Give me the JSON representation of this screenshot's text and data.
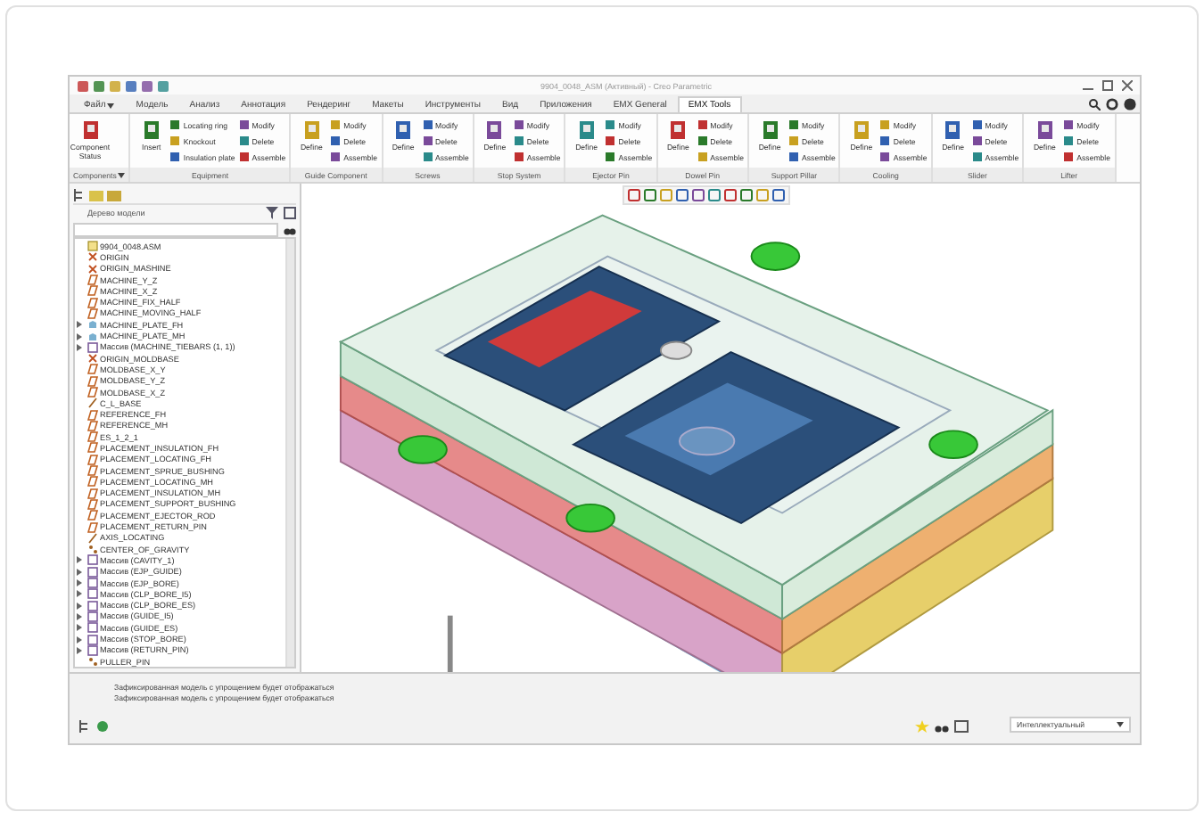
{
  "window": {
    "title": "9904_0048_ASM (Активный) - Creo Parametric"
  },
  "tabs": [
    {
      "label": "Файл",
      "selected": false,
      "menu": true
    },
    {
      "label": "Модель",
      "selected": false,
      "menu": false
    },
    {
      "label": "Анализ",
      "selected": false,
      "menu": false
    },
    {
      "label": "Аннотация",
      "selected": false,
      "menu": false
    },
    {
      "label": "Рендеринг",
      "selected": false,
      "menu": false
    },
    {
      "label": "Макеты",
      "selected": false,
      "menu": false
    },
    {
      "label": "Инструменты",
      "selected": false,
      "menu": false
    },
    {
      "label": "Вид",
      "selected": false,
      "menu": false
    },
    {
      "label": "Приложения",
      "selected": false,
      "menu": false
    },
    {
      "label": "EMX General",
      "selected": false,
      "menu": false
    },
    {
      "label": "EMX Tools",
      "selected": true,
      "menu": false
    }
  ],
  "ribbon_groups": [
    {
      "label": "Components",
      "menu": true,
      "large": [
        "Component Status"
      ]
    },
    {
      "label": "Equipment",
      "menu": false,
      "large": [
        "Insert"
      ],
      "small": [
        "Locating ring",
        "Knockout",
        "Insulation plate",
        "Modify",
        "Delete",
        "Assemble"
      ]
    },
    {
      "label": "Guide Component",
      "menu": false,
      "large": [
        "Define"
      ],
      "small": [
        "Modify",
        "Delete",
        "Assemble"
      ]
    },
    {
      "label": "Screws",
      "menu": false,
      "large": [
        "Define"
      ],
      "small": [
        "Modify",
        "Delete",
        "Assemble"
      ]
    },
    {
      "label": "Stop System",
      "menu": false,
      "large": [
        "Define"
      ],
      "small": [
        "Modify",
        "Delete",
        "Assemble"
      ]
    },
    {
      "label": "Ejector Pin",
      "menu": false,
      "large": [
        "Define"
      ],
      "small": [
        "Modify",
        "Delete",
        "Assemble"
      ]
    },
    {
      "label": "Dowel Pin",
      "menu": false,
      "large": [
        "Define"
      ],
      "small": [
        "Modify",
        "Delete",
        "Assemble"
      ]
    },
    {
      "label": "Support Pillar",
      "menu": false,
      "large": [
        "Define"
      ],
      "small": [
        "Modify",
        "Delete",
        "Assemble"
      ]
    },
    {
      "label": "Cooling",
      "menu": false,
      "large": [
        "Define"
      ],
      "small": [
        "Modify",
        "Delete",
        "Assemble"
      ]
    },
    {
      "label": "Slider",
      "menu": false,
      "large": [
        "Define"
      ],
      "small": [
        "Modify",
        "Delete",
        "Assemble"
      ]
    },
    {
      "label": "Lifter",
      "menu": false,
      "large": [
        "Define"
      ],
      "small": [
        "Modify",
        "Delete",
        "Assemble"
      ]
    }
  ],
  "model_tree": {
    "title": "Дерево модели",
    "items": [
      {
        "label": "9904_0048.ASM",
        "kind": "assembly",
        "expandable": false
      },
      {
        "label": "ORIGIN",
        "kind": "csys",
        "expandable": false
      },
      {
        "label": "ORIGIN_MASHINE",
        "kind": "csys",
        "expandable": false
      },
      {
        "label": "MACHINE_Y_Z",
        "kind": "plane",
        "expandable": false
      },
      {
        "label": "MACHINE_X_Z",
        "kind": "plane",
        "expandable": false
      },
      {
        "label": "MACHINE_FIX_HALF",
        "kind": "plane",
        "expandable": false
      },
      {
        "label": "MACHINE_MOVING_HALF",
        "kind": "plane",
        "expandable": false
      },
      {
        "label": "MACHINE_PLATE_FH",
        "kind": "part",
        "expandable": true
      },
      {
        "label": "MACHINE_PLATE_MH",
        "kind": "part",
        "expandable": true
      },
      {
        "label": "Массив (MACHINE_TIEBARS (1, 1))",
        "kind": "pattern",
        "expandable": true
      },
      {
        "label": "ORIGIN_MOLDBASE",
        "kind": "csys",
        "expandable": false
      },
      {
        "label": "MOLDBASE_X_Y",
        "kind": "plane",
        "expandable": false
      },
      {
        "label": "MOLDBASE_Y_Z",
        "kind": "plane",
        "expandable": false
      },
      {
        "label": "MOLDBASE_X_Z",
        "kind": "plane",
        "expandable": false
      },
      {
        "label": "C_L_BASE",
        "kind": "axis",
        "expandable": false
      },
      {
        "label": "REFERENCE_FH",
        "kind": "plane",
        "expandable": false
      },
      {
        "label": "REFERENCE_MH",
        "kind": "plane",
        "expandable": false
      },
      {
        "label": "ES_1_2_1",
        "kind": "plane",
        "expandable": false
      },
      {
        "label": "PLACEMENT_INSULATION_FH",
        "kind": "plane",
        "expandable": false
      },
      {
        "label": "PLACEMENT_LOCATING_FH",
        "kind": "plane",
        "expandable": false
      },
      {
        "label": "PLACEMENT_SPRUE_BUSHING",
        "kind": "plane",
        "expandable": false
      },
      {
        "label": "PLACEMENT_LOCATING_MH",
        "kind": "plane",
        "expandable": false
      },
      {
        "label": "PLACEMENT_INSULATION_MH",
        "kind": "plane",
        "expandable": false
      },
      {
        "label": "PLACEMENT_SUPPORT_BUSHING",
        "kind": "plane",
        "expandable": false
      },
      {
        "label": "PLACEMENT_EJECTOR_ROD",
        "kind": "plane",
        "expandable": false
      },
      {
        "label": "PLACEMENT_RETURN_PIN",
        "kind": "plane",
        "expandable": false
      },
      {
        "label": "AXIS_LOCATING",
        "kind": "axis",
        "expandable": false
      },
      {
        "label": "CENTER_OF_GRAVITY",
        "kind": "point",
        "expandable": false
      },
      {
        "label": "Массив (CAVITY_1)",
        "kind": "pattern",
        "expandable": true
      },
      {
        "label": "Массив (EJP_GUIDE)",
        "kind": "pattern",
        "expandable": true
      },
      {
        "label": "Массив (EJP_BORE)",
        "kind": "pattern",
        "expandable": true
      },
      {
        "label": "Массив (CLP_BORE_I5)",
        "kind": "pattern",
        "expandable": true
      },
      {
        "label": "Массив (CLP_BORE_ES)",
        "kind": "pattern",
        "expandable": true
      },
      {
        "label": "Массив (GUIDE_I5)",
        "kind": "pattern",
        "expandable": true
      },
      {
        "label": "Массив (GUIDE_ES)",
        "kind": "pattern",
        "expandable": true
      },
      {
        "label": "Массив (STOP_BORE)",
        "kind": "pattern",
        "expandable": true
      },
      {
        "label": "Массив (RETURN_PIN)",
        "kind": "pattern",
        "expandable": true
      },
      {
        "label": "PULLER_PIN",
        "kind": "point",
        "expandable": false
      }
    ]
  },
  "status_bar": {
    "messages": [
      "Зафиксированная модель с упрощением будет отображаться",
      "Зафиксированная модель с упрощением будет отображаться"
    ],
    "filter": "Интеллектуальный"
  }
}
